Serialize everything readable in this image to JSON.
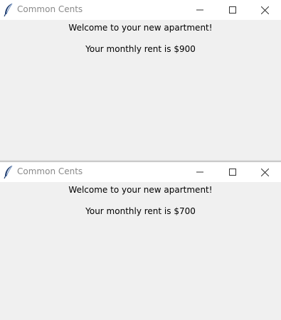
{
  "windows": [
    {
      "title": "Common Cents",
      "welcome_text": "Welcome to your new apartment!",
      "rent_text": "Your monthly rent is $900"
    },
    {
      "title": "Common Cents",
      "welcome_text": "Welcome to your new apartment!",
      "rent_text": "Your monthly rent is $700"
    }
  ],
  "icons": {
    "app": "feather-icon",
    "minimize": "minimize-icon",
    "maximize": "maximize-icon",
    "close": "close-icon"
  },
  "colors": {
    "titlebar_bg": "#ffffff",
    "window_bg": "#f0f0f0",
    "title_text": "#8a8a8a",
    "body_text": "#000000"
  }
}
